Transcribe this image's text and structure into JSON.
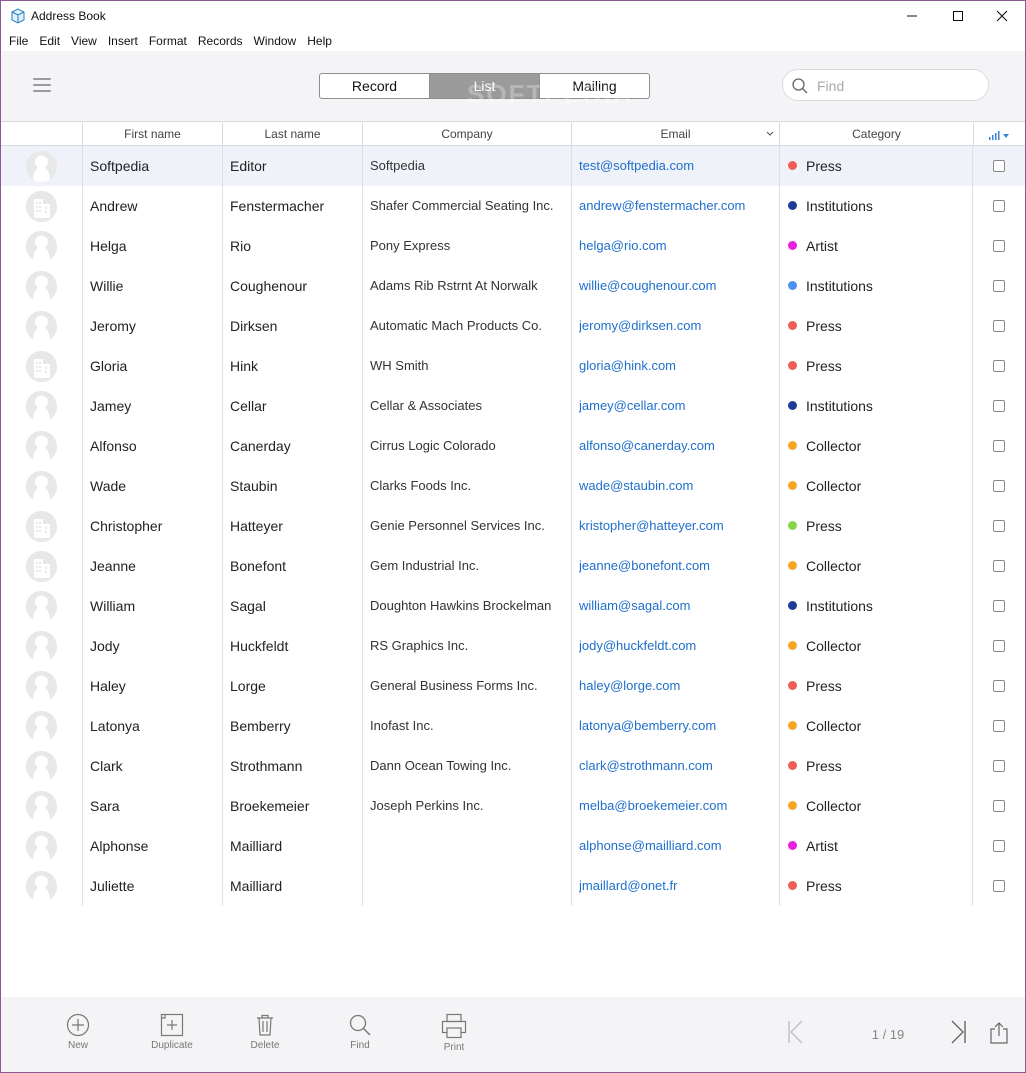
{
  "window": {
    "title": "Address Book",
    "controls": [
      "minimize-icon",
      "maximize-icon",
      "close-icon"
    ]
  },
  "menu": [
    "File",
    "Edit",
    "View",
    "Insert",
    "Format",
    "Records",
    "Window",
    "Help"
  ],
  "toolbar": {
    "views": [
      "Record",
      "List",
      "Mailing"
    ],
    "active_view": "List",
    "search_placeholder": "Find",
    "watermark": "SOFTPEDIA"
  },
  "columns": {
    "first": "First name",
    "last": "Last name",
    "company": "Company",
    "email": "Email",
    "category": "Category"
  },
  "category_colors": {
    "Press": "#f25c54",
    "Institutions": "#1f3b99",
    "Artist": "#e91ee0",
    "Collector": "#f5a623",
    "Institutions-light": "#4a90f5",
    "Press-green": "#86d64a"
  },
  "rows": [
    {
      "first": "Softpedia",
      "last": "Editor",
      "company": "Softpedia",
      "email": "test@softpedia.com",
      "category": "Press",
      "color": "#f25c54",
      "avatar": "person",
      "selected": true
    },
    {
      "first": "Andrew",
      "last": "Fenstermacher",
      "company": "Shafer Commercial Seating Inc.",
      "email": "andrew@fenstermacher.com",
      "category": "Institutions",
      "color": "#1f3b99",
      "avatar": "building"
    },
    {
      "first": "Helga",
      "last": "Rio",
      "company": "Pony Express",
      "email": "helga@rio.com",
      "category": "Artist",
      "color": "#e91ee0",
      "avatar": "person"
    },
    {
      "first": "Willie",
      "last": "Coughenour",
      "company": "Adams Rib Rstrnt At Norwalk",
      "email": "willie@coughenour.com",
      "category": "Institutions",
      "color": "#4a90f5",
      "avatar": "person"
    },
    {
      "first": "Jeromy",
      "last": "Dirksen",
      "company": "Automatic Mach Products Co.",
      "email": "jeromy@dirksen.com",
      "category": "Press",
      "color": "#f25c54",
      "avatar": "person"
    },
    {
      "first": "Gloria",
      "last": "Hink",
      "company": "WH Smith",
      "email": "gloria@hink.com",
      "category": "Press",
      "color": "#f25c54",
      "avatar": "building"
    },
    {
      "first": "Jamey",
      "last": "Cellar",
      "company": "Cellar & Associates",
      "email": "jamey@cellar.com",
      "category": "Institutions",
      "color": "#1f3b99",
      "avatar": "person"
    },
    {
      "first": "Alfonso",
      "last": "Canerday",
      "company": "Cirrus Logic Colorado",
      "email": "alfonso@canerday.com",
      "category": "Collector",
      "color": "#f5a623",
      "avatar": "person"
    },
    {
      "first": "Wade",
      "last": "Staubin",
      "company": "Clarks Foods Inc.",
      "email": "wade@staubin.com",
      "category": "Collector",
      "color": "#f5a623",
      "avatar": "person"
    },
    {
      "first": "Christopher",
      "last": "Hatteyer",
      "company": "Genie Personnel Services Inc.",
      "email": "kristopher@hatteyer.com",
      "category": "Press",
      "color": "#86d64a",
      "avatar": "building"
    },
    {
      "first": "Jeanne",
      "last": "Bonefont",
      "company": "Gem Industrial Inc.",
      "email": "jeanne@bonefont.com",
      "category": "Collector",
      "color": "#f5a623",
      "avatar": "building"
    },
    {
      "first": "William",
      "last": "Sagal",
      "company": "Doughton Hawkins Brockelman",
      "email": "william@sagal.com",
      "category": "Institutions",
      "color": "#1f3b99",
      "avatar": "person"
    },
    {
      "first": "Jody",
      "last": "Huckfeldt",
      "company": "RS Graphics Inc.",
      "email": "jody@huckfeldt.com",
      "category": "Collector",
      "color": "#f5a623",
      "avatar": "person"
    },
    {
      "first": "Haley",
      "last": "Lorge",
      "company": "General Business Forms Inc.",
      "email": "haley@lorge.com",
      "category": "Press",
      "color": "#f25c54",
      "avatar": "person"
    },
    {
      "first": "Latonya",
      "last": "Bemberry",
      "company": "Inofast Inc.",
      "email": "latonya@bemberry.com",
      "category": "Collector",
      "color": "#f5a623",
      "avatar": "person"
    },
    {
      "first": "Clark",
      "last": "Strothmann",
      "company": "Dann Ocean Towing Inc.",
      "email": "clark@strothmann.com",
      "category": "Press",
      "color": "#f25c54",
      "avatar": "person"
    },
    {
      "first": "Sara",
      "last": "Broekemeier",
      "company": "Joseph Perkins Inc.",
      "email": "melba@broekemeier.com",
      "category": "Collector",
      "color": "#f5a623",
      "avatar": "person"
    },
    {
      "first": "Alphonse",
      "last": "Mailliard",
      "company": "",
      "email": "alphonse@mailliard.com",
      "category": "Artist",
      "color": "#e91ee0",
      "avatar": "person"
    },
    {
      "first": "Juliette",
      "last": "Mailliard",
      "company": "",
      "email": "jmaillard@onet.fr",
      "category": "Press",
      "color": "#f25c54",
      "avatar": "person"
    }
  ],
  "bottom_tools": [
    {
      "label": "New",
      "icon": "plus-circle-icon"
    },
    {
      "label": "Duplicate",
      "icon": "duplicate-icon"
    },
    {
      "label": "Delete",
      "icon": "trash-icon"
    },
    {
      "label": "Find",
      "icon": "search-icon"
    },
    {
      "label": "Print",
      "icon": "printer-icon"
    }
  ],
  "pager": {
    "text": "1 / 19"
  }
}
